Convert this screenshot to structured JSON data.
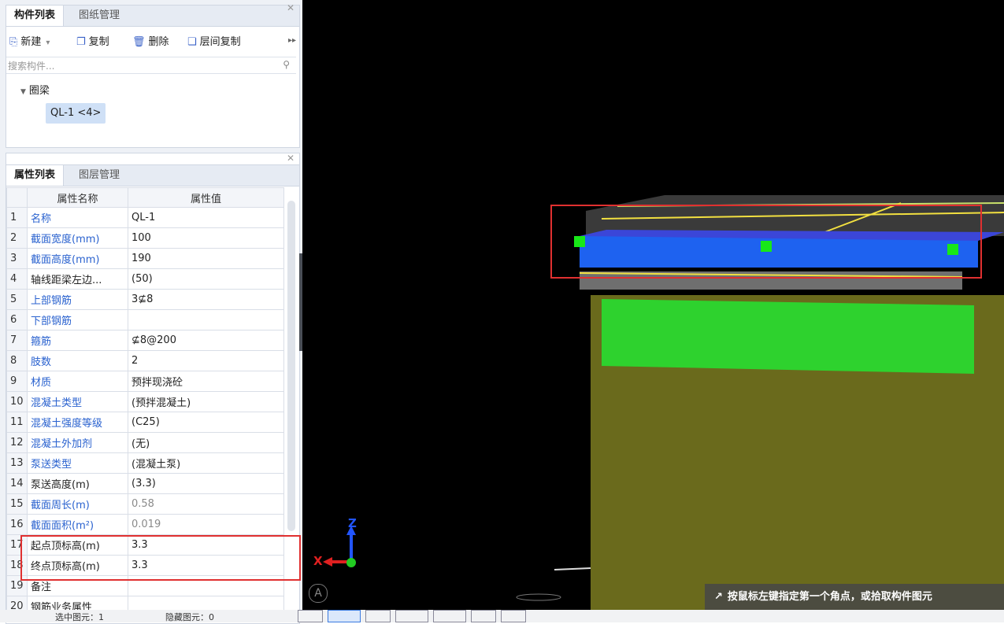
{
  "component_panel": {
    "tabs": [
      "构件列表",
      "图纸管理"
    ],
    "toolbar": {
      "new": "新建",
      "copy": "复制",
      "delete": "删除",
      "floor_copy": "层间复制"
    },
    "search_placeholder": "搜索构件...",
    "tree_group": "圈梁",
    "tree_item": "QL-1 <4>"
  },
  "property_panel": {
    "tabs": [
      "属性列表",
      "图层管理"
    ],
    "col_name": "属性名称",
    "col_value": "属性值",
    "rows": [
      {
        "idx": "1",
        "name": "名称",
        "value": "QL-1"
      },
      {
        "idx": "2",
        "name": "截面宽度(mm)",
        "value": "100"
      },
      {
        "idx": "3",
        "name": "截面高度(mm)",
        "value": "190"
      },
      {
        "idx": "4",
        "name": "轴线距梁左边...",
        "value": "(50)"
      },
      {
        "idx": "5",
        "name": "上部钢筋",
        "value": "3⊈8"
      },
      {
        "idx": "6",
        "name": "下部钢筋",
        "value": ""
      },
      {
        "idx": "7",
        "name": "箍筋",
        "value": "⊈8@200"
      },
      {
        "idx": "8",
        "name": "肢数",
        "value": "2"
      },
      {
        "idx": "9",
        "name": "材质",
        "value": "预拌现浇砼"
      },
      {
        "idx": "10",
        "name": "混凝土类型",
        "value": "(预拌混凝土)"
      },
      {
        "idx": "11",
        "name": "混凝土强度等级",
        "value": "(C25)"
      },
      {
        "idx": "12",
        "name": "混凝土外加剂",
        "value": "(无)"
      },
      {
        "idx": "13",
        "name": "泵送类型",
        "value": "(混凝土泵)"
      },
      {
        "idx": "14",
        "name": "泵送高度(m)",
        "value": "(3.3)"
      },
      {
        "idx": "15",
        "name": "截面周长(m)",
        "value": "0.58"
      },
      {
        "idx": "16",
        "name": "截面面积(m²)",
        "value": "0.019"
      },
      {
        "idx": "17",
        "name": "起点顶标高(m)",
        "value": "3.3"
      },
      {
        "idx": "18",
        "name": "终点顶标高(m)",
        "value": "3.3"
      },
      {
        "idx": "19",
        "name": "备注",
        "value": ""
      },
      {
        "idx": "20",
        "name": "钢筋业务属性",
        "value": ""
      }
    ]
  },
  "viewport": {
    "axis_x": "X",
    "axis_z": "Z",
    "hint": "按鼠标左键指定第一个角点，或拾取构件图元",
    "mode_letter": "A"
  },
  "statusbar": {
    "left": "选中图元：1",
    "mid": "隐藏图元：0"
  }
}
